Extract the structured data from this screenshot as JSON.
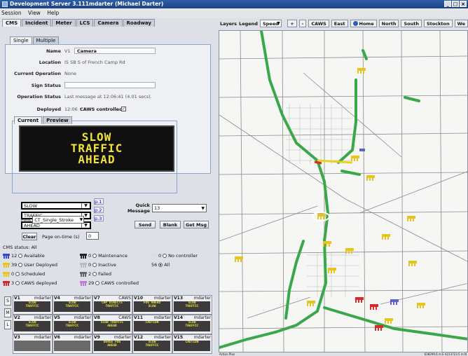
{
  "title": "Development Server 3.111mdarter (Michael Darter)",
  "menu": [
    "Session",
    "View",
    "Help"
  ],
  "main_tabs": [
    "CMS",
    "Incident",
    "Meter",
    "LCS",
    "Camera",
    "Roadway"
  ],
  "sub_tabs": [
    "Single",
    "Multiple"
  ],
  "form": {
    "name_label": "Name",
    "name_value": "V1",
    "camera_label": "Camera",
    "location_label": "Location",
    "location_value": "I5 SB S of French Camp Rd",
    "current_op_label": "Current Operation",
    "current_op_value": "None",
    "sign_status_label": "Sign Status",
    "op_status_label": "Operation Status",
    "op_status_value": "Last message at 12:06:41 (4.01 secs).",
    "deployed_label": "Deployed",
    "deployed_value": "12:06",
    "caws_label": "CAWS controlled"
  },
  "sign_tabs": [
    "Current",
    "Preview"
  ],
  "sign_lines": [
    "SLOW",
    "TRAFFIC",
    "AHEAD"
  ],
  "message_lines": [
    "SLOW",
    "TRAFFIC",
    "AHEAD"
  ],
  "page_buttons": [
    "p.1",
    "p.2",
    "p.3"
  ],
  "font_label": "Font",
  "font_value": "CT_Single_Stroke",
  "quick_message_label": "Quick Message",
  "quick_message_value": "13",
  "buttons": {
    "send": "Send",
    "blank": "Blank",
    "get_msg": "Get Msg",
    "clear": "Clear"
  },
  "page_on_time_label": "Page on-time (s)",
  "page_on_time_value": "0",
  "cms_status_label": "CMS status: All",
  "status": [
    {
      "count": "12",
      "label": "Available",
      "color": "#3a49c8"
    },
    {
      "count": "39",
      "label": "User Deployed",
      "color": "#e8c420"
    },
    {
      "count": "0",
      "label": "Scheduled",
      "color": "#e8c420"
    },
    {
      "count": "3",
      "label": "CAWS deployed",
      "color": "#d42a2a"
    },
    {
      "count": "0",
      "label": "Maintenance",
      "color": "#222222"
    },
    {
      "count": "0",
      "label": "Inactive",
      "color": "#bbbbbb"
    },
    {
      "count": "2",
      "label": "Failed",
      "color": "#666666"
    },
    {
      "count": "29",
      "label": "CAWS controlled",
      "color": "#c07ad8"
    },
    {
      "count": "0",
      "label": "No controller",
      "color": "#dddddd"
    },
    {
      "count": "56",
      "label": "All",
      "color": "#000000"
    }
  ],
  "side_buttons": [
    "S",
    "M",
    "L"
  ],
  "sign_grid": [
    {
      "id": "V1",
      "user": "mdarter",
      "text": [
        "SLOW",
        "TRAFFIC"
      ]
    },
    {
      "id": "V4",
      "user": "mdarter",
      "text": [
        "SLOW",
        "TRAFFIC"
      ]
    },
    {
      "id": "V7",
      "user": "CAWS",
      "text": [
        "CHP DIRECTS",
        "TRAFFIC"
      ]
    },
    {
      "id": "V10",
      "user": "mdarter",
      "text": [
        "FOG AHEAD",
        "SLOW"
      ]
    },
    {
      "id": "V13",
      "user": "mdarter",
      "text": [
        "SLOW",
        "TRAFFIC"
      ]
    },
    {
      "id": "V2",
      "user": "mdarter",
      "text": [
        "SLOW",
        "TRAFFIC"
      ]
    },
    {
      "id": "V5",
      "user": "mdarter",
      "text": [
        "SLOW",
        "TRAFFIC"
      ]
    },
    {
      "id": "V8",
      "user": "CAWS",
      "text": [
        "SLOW TRAFFIC",
        "AHEAD"
      ]
    },
    {
      "id": "V11",
      "user": "mdarter",
      "text": [
        "CAUTION",
        ""
      ]
    },
    {
      "id": "V14",
      "user": "mdarter",
      "text": [
        "SLOW",
        "TRAFFIC"
      ]
    },
    {
      "id": "V3",
      "user": "mdarter",
      "text": [
        "",
        ""
      ]
    },
    {
      "id": "V6",
      "user": "mdarter",
      "text": [
        "",
        ""
      ]
    },
    {
      "id": "V9",
      "user": "mdarter",
      "text": [
        "DENSE FOG",
        "AHEAD"
      ]
    },
    {
      "id": "V12",
      "user": "mdarter",
      "text": [
        "SLOW",
        "TRAFFIC"
      ]
    },
    {
      "id": "V15",
      "user": "mdarter",
      "text": [
        "CAUTION",
        ""
      ]
    }
  ],
  "map_toolbar": {
    "layers": "Layers",
    "legend": "Legend",
    "speed": "Speed",
    "buttons": [
      "+",
      "-",
      "CAWS",
      "East",
      "Home",
      "North",
      "South",
      "Stockton",
      "We"
    ]
  },
  "map_status": {
    "action_plan": "Action Plan",
    "coords": "638299.6 m E 4213723.5 m N"
  }
}
